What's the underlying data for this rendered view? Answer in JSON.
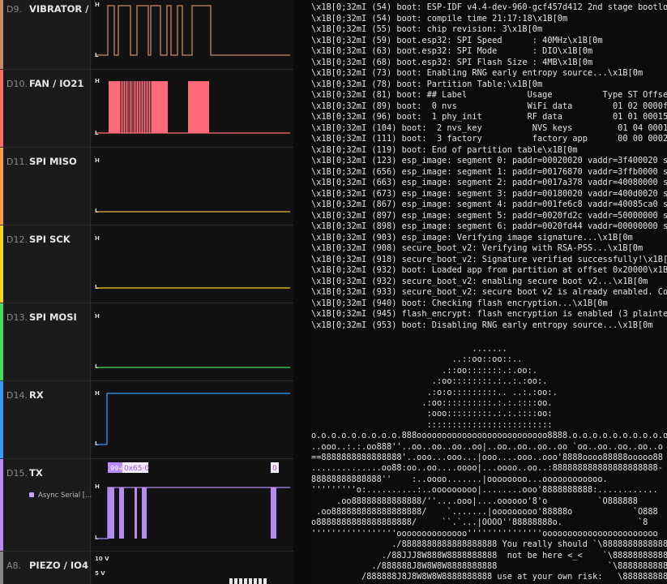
{
  "channels": [
    {
      "id": "D9.",
      "name": "VIBRATOR / ...",
      "color": "#c8876a"
    },
    {
      "id": "D10.",
      "name": "FAN  / IO21",
      "color": "#ff6b6b"
    },
    {
      "id": "D11.",
      "name": "SPI MISO",
      "color": "#ff9f43"
    },
    {
      "id": "D12.",
      "name": "SPI SCK",
      "color": "#f9d423"
    },
    {
      "id": "D13.",
      "name": "SPI MOSI",
      "color": "#4cd964"
    },
    {
      "id": "D14.",
      "name": "RX",
      "color": "#3a9bfc"
    },
    {
      "id": "D15.",
      "name": "TX",
      "color": "#b78cff",
      "analyzer_label": "Async Serial [...",
      "frames": [
        "99+",
        "0x65·0",
        "0"
      ]
    },
    {
      "id": "A8.",
      "name": "PIEZO / IO4",
      "color": "#888888",
      "scale": [
        "10 V",
        "5 V"
      ]
    }
  ],
  "level_labels": {
    "high": "H",
    "low": "L"
  },
  "log_lines": [
    "\\x1B[0;32mI (54) boot: ESP-IDF v4.4-dev-960-gcf457d412 2nd stage bootloa",
    "\\x1B[0;32mI (54) boot: compile time 21:17:18\\x1B[0m",
    "\\x1B[0;32mI (55) boot: chip revision: 3\\x1B[0m",
    "\\x1B[0;32mI (59) boot.esp32: SPI Speed      : 40MHz\\x1B[0m",
    "\\x1B[0;32mI (63) boot.esp32: SPI Mode       : DIO\\x1B[0m",
    "\\x1B[0;32mI (68) boot.esp32: SPI Flash Size : 4MB\\x1B[0m",
    "\\x1B[0;32mI (73) boot: Enabling RNG early entropy source...\\x1B[0m",
    "\\x1B[0;32mI (78) boot: Partition Table:\\x1B[0m",
    "\\x1B[0;32mI (81) boot: ## Label            Usage          Type ST Offset",
    "\\x1B[0;32mI (89) boot:  0 nvs              WiFi data        01 02 0000f00",
    "\\x1B[0;32mI (96) boot:  1 phy_init         RF data          01 01 0001500",
    "\\x1B[0;32mI (104) boot:  2 nvs_key          NVS keys         01 04 000160",
    "\\x1B[0;32mI (111) boot:  3 factory          factory app      00 00 000200",
    "\\x1B[0;32mI (119) boot: End of partition table\\x1B[0m",
    "\\x1B[0;32mI (123) esp_image: segment 0: paddr=00020020 vaddr=3f400020 si",
    "\\x1B[0;32mI (656) esp_image: segment 1: paddr=00176870 vaddr=3ffb0000 si",
    "\\x1B[0;32mI (663) esp_image: segment 2: paddr=0017a378 vaddr=40080000 si",
    "\\x1B[0;32mI (673) esp_image: segment 3: paddr=00180020 vaddr=400d0020 si",
    "\\x1B[0;32mI (867) esp_image: segment 4: paddr=001fe6c8 vaddr=40085ca0 si",
    "\\x1B[0;32mI (897) esp_image: segment 5: paddr=0020fd2c vaddr=50000000 si",
    "\\x1B[0;32mI (898) esp_image: segment 6: paddr=0020fd44 vaddr=00000000 si",
    "\\x1B[0;32mI (903) esp_image: Verifying image signature...\\x1B[0m",
    "\\x1B[0;32mI (908) secure_boot_v2: Verifying with RSA-PSS...\\x1B[0m",
    "\\x1B[0;32mI (918) secure_boot_v2: Signature verified successfully!\\x1B[0",
    "\\x1B[0;32mI (932) boot: Loaded app from partition at offset 0x20000\\x1B[0",
    "\\x1B[0;32mI (932) secure_boot_v2: enabling secure boot v2...\\x1B[0m",
    "\\x1B[0;32mI (933) secure_boot_v2: secure boot v2 is already enabled. Cont",
    "\\x1B[0;32mI (940) boot: Checking flash encryption...\\x1B[0m",
    "\\x1B[0;32mI (945) flash_encrypt: flash encryption is enabled (3 plaintex",
    "\\x1B[0;32mI (953) boot: Disabling RNG early entropy source...\\x1B[0m"
  ],
  "ascii_art": [
    "                                .......",
    "                            ..::oo::oo::..",
    "                          .::oo:::::::.:.oo:.",
    "                        .:oo::::::::.:..:.:oo:.",
    "                       .:o:o:::::::::.. ..:.:oo:.",
    "                      .:oo::::::::::.:.:.::::oo.",
    "                       :ooo:::::::::.:.:.::::oo:",
    "                       :::::::::::::::::::::::::",
    "o.o.o.o.o.o.o.o.o.888oooooooooooooooooooooooooo8888.o.o.o.o.o.o.o.o.o.o.",
    "..ooo..:.:.oo888''..oo..oo..oo..oo|..oo..oo..oo..oo `oo..oo..oo..oo..o",
    "==8888888888888888'..ooo...ooo...|ooo....ooo..ooo'8888oooo88888ooooo88",
    "..............oo88:oo..oo....oooo|...oooo..oo..:888888888888888888888-",
    "88888888888888''    :..oooo.......|oooooooo...oooooooooooo.",
    "'''''''''o:..........:..ooooooooo|........ooo'8888888888:............",
    "     .oo88888888888888/''....ooo|....oooooo'8'o          `O888888",
    " .oo888888888888888888/    `.......|ooooooooo'88888o            `O888",
    "o8888888888888888888/     ``.`...|OOOO''88888888o.               `8",
    "'''''''''''''''''oooooooooooooo'''''''''''''''ooooooooooooooooooooooo",
    "                ./8888888888888888888 You really should `\\8888888888888888",
    "              ./88JJJ8W888W8888888888  not be here <_<    `\\888888888888888",
    "            ./888888J8W8W8W8888888888                      `\\88888888888888",
    "          /888888J8J8W8W8W8888888888 use at your own risk:   \\888888888888"
  ]
}
